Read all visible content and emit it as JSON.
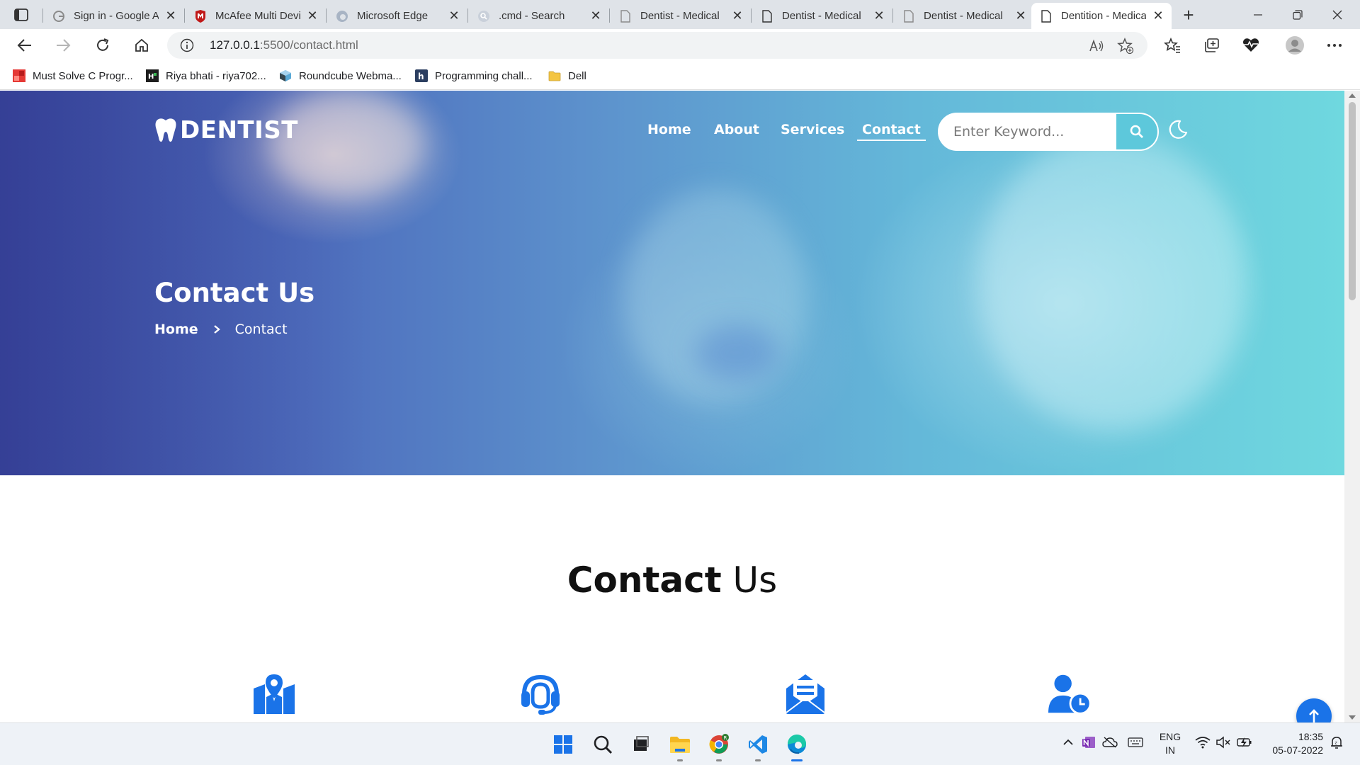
{
  "browser": {
    "tabs": [
      {
        "title": "Sign in - Google Accounts",
        "icon": "google-icon"
      },
      {
        "title": "McAfee Multi Device Security",
        "icon": "mcafee-icon"
      },
      {
        "title": "Microsoft Edge",
        "icon": "edge-icon"
      },
      {
        "title": ".cmd - Search",
        "icon": "search-icon"
      },
      {
        "title": "Dentist - Medical",
        "icon": "page-icon"
      },
      {
        "title": "Dentist - Medical",
        "icon": "page-icon"
      },
      {
        "title": "Dentist - Medical",
        "icon": "page-icon"
      },
      {
        "title": "Dentition - Medical",
        "icon": "page-icon",
        "active": true
      }
    ],
    "address": {
      "host": "127.0.0.1",
      "rest": ":5500/contact.html"
    },
    "bookmarks": [
      {
        "label": "Must Solve C Progr...",
        "icon": "red-bookmark-icon"
      },
      {
        "label": "Riya bhati - riya702...",
        "icon": "hackerearth-icon"
      },
      {
        "label": "Roundcube Webma...",
        "icon": "roundcube-icon"
      },
      {
        "label": "Programming chall...",
        "icon": "hackerrank-icon"
      },
      {
        "label": "Dell",
        "icon": "folder-icon"
      }
    ]
  },
  "site": {
    "brand": "DENTIST",
    "nav": [
      {
        "label": "Home"
      },
      {
        "label": "About"
      },
      {
        "label": "Services"
      },
      {
        "label": "Contact",
        "active": true
      }
    ],
    "search_placeholder": "Enter Keyword...",
    "hero_title": "Contact Us",
    "breadcrumb": {
      "home": "Home",
      "current": "Contact"
    },
    "section_title_bold": "Contact",
    "section_title_light": "Us",
    "contact_icons": [
      "map-location-icon",
      "headset-support-icon",
      "envelope-open-icon",
      "user-clock-icon"
    ],
    "accent_color": "#1a73e8",
    "search_button_color": "#5dc8db"
  },
  "taskbar": {
    "apps": [
      "windows-start-icon",
      "search-icon",
      "task-view-icon",
      "file-explorer-icon",
      "chrome-icon",
      "vscode-icon",
      "edge-icon"
    ],
    "language": {
      "line1": "ENG",
      "line2": "IN"
    },
    "time": "18:35",
    "date": "05-07-2022"
  }
}
